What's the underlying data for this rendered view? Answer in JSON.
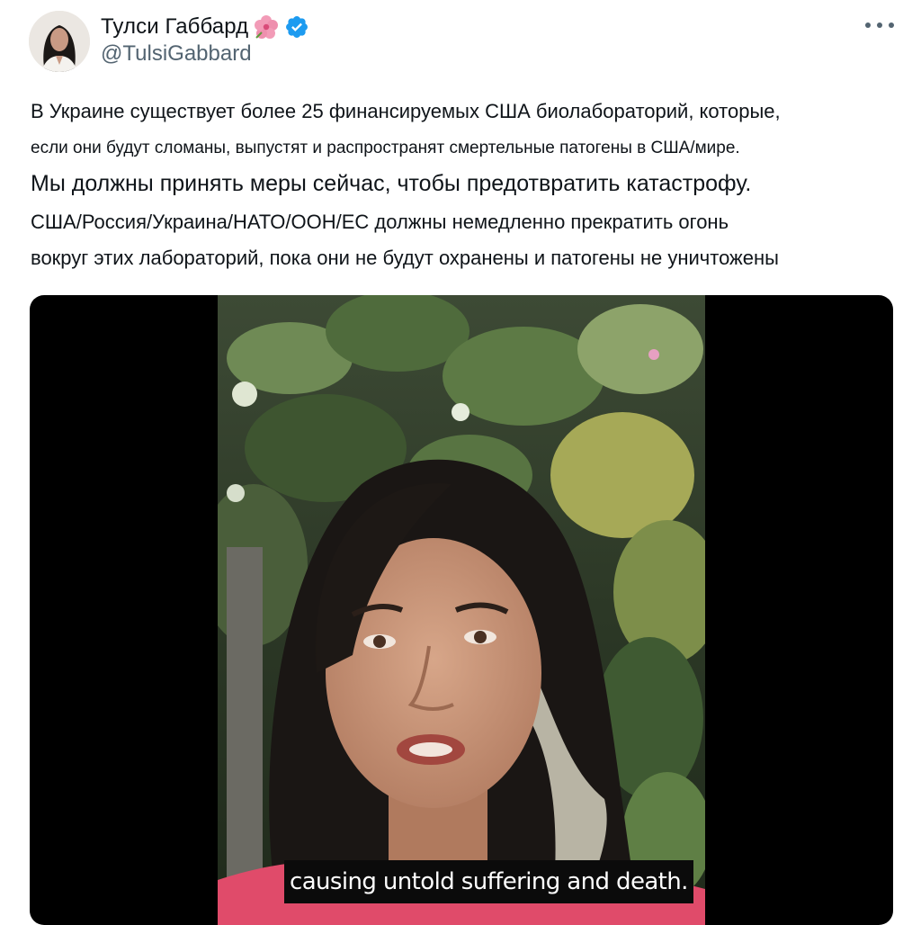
{
  "author": {
    "display_name": "Тулси Габбард",
    "handle": "@TulsiGabbard",
    "emoji_icon": "hibiscus-flower-icon",
    "verified_icon": "verified-badge-icon",
    "verified_color": "#1d9bf0"
  },
  "more_icon": "more-options-icon",
  "tweet": {
    "lines": [
      "В Украине существует более 25 финансируемых США биолабораторий, которые,",
      "если они будут сломаны, выпустят и распространят смертельные патогены в США/мире.",
      "Мы должны принять меры сейчас, чтобы предотвратить катастрофу.",
      "США/Россия/Украина/НАТО/ООН/ЕС должны немедленно прекратить огонь",
      "вокруг этих лабораторий, пока они не будут охранены и патогены не уничтожены"
    ]
  },
  "video": {
    "caption": "causing untold suffering and death."
  },
  "colors": {
    "text": "#0f1419",
    "secondary": "#536471",
    "video_bg": "#000000"
  }
}
